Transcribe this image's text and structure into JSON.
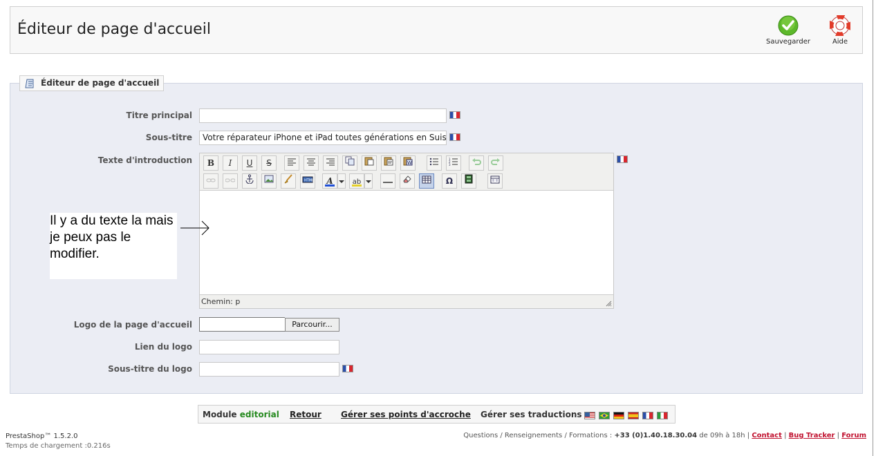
{
  "header": {
    "title": "Éditeur de page d'accueil",
    "save_label": "Sauvegarder",
    "help_label": "Aide"
  },
  "fieldset": {
    "legend": "Éditeur de page d'accueil"
  },
  "form": {
    "main_title_label": "Titre principal",
    "main_title_value": "",
    "subtitle_label": "Sous-titre",
    "subtitle_value": "Votre réparateur iPhone et iPad toutes générations en Suisse R",
    "intro_label": "Texte d'introduction",
    "editor_path": "Chemin: p",
    "logo_label": "Logo de la page d'accueil",
    "browse_label": "Parcourir...",
    "logo_link_label": "Lien du logo",
    "logo_subtitle_label": "Sous-titre du logo"
  },
  "annotation": {
    "text": "Il y a du texte la mais je peux pas le modifier."
  },
  "footer_bar": {
    "module_prefix": "Module",
    "module_name": "editorial",
    "back": "Retour",
    "hooks": "Gérer ses points d'accroche",
    "translations": "Gérer ses traductions :"
  },
  "bottom": {
    "version": "PrestaShop™ 1.5.2.0",
    "load_time": "Temps de chargement :0.216s",
    "questions_text": "Questions / Renseignements / Formations :",
    "phone": "+33 (0)1.40.18.30.04",
    "hours": "de 09h à 18h |",
    "contact": "Contact",
    "bug_tracker": "Bug Tracker",
    "forum": "Forum",
    "sep": "|"
  },
  "colors": {
    "fieldset_bg": "#ebedf4",
    "module_green": "#268a1f",
    "link_red": "#c0102e"
  }
}
